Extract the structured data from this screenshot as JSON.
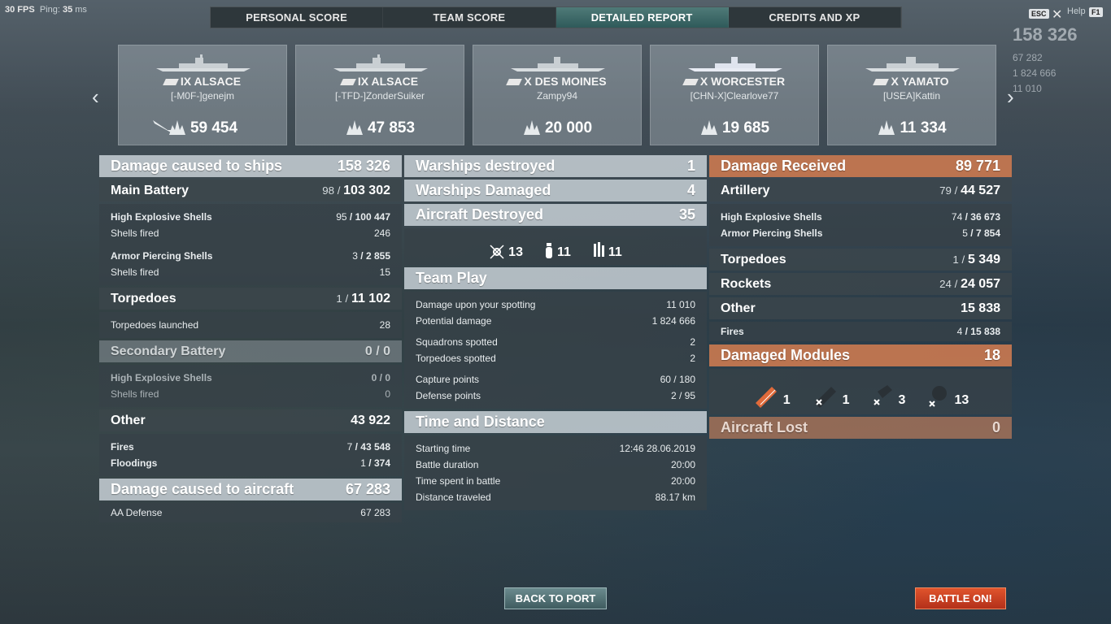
{
  "hud": {
    "fps_label": "30 FPS",
    "ping_label": "Ping:",
    "ping_value": "35",
    "ping_unit": "ms"
  },
  "tabs": [
    {
      "label": "PERSONAL SCORE"
    },
    {
      "label": "TEAM SCORE"
    },
    {
      "label": "DETAILED REPORT"
    },
    {
      "label": "CREDITS AND XP"
    }
  ],
  "window": {
    "esc": "ESC",
    "help": "Help",
    "f1": "F1"
  },
  "cards": [
    {
      "ship": "IX ALSACE",
      "player": "[-M0F-]genejm",
      "damage": "59 454"
    },
    {
      "ship": "IX ALSACE",
      "player": "[-TFD-]ZonderSuiker",
      "damage": "47 853"
    },
    {
      "ship": "X DES MOINES",
      "player": "Zampy94",
      "damage": "20 000"
    },
    {
      "ship": "X WORCESTER",
      "player": "[CHN-X]Clearlove77",
      "damage": "19 685"
    },
    {
      "ship": "X YAMATO",
      "player": "[USEA]Kattin",
      "damage": "11 334"
    }
  ],
  "left": {
    "damage_ships": {
      "label": "Damage caused to ships",
      "value": "158 326"
    },
    "main_battery": {
      "label": "Main Battery",
      "hits": "98",
      "total": "103 302"
    },
    "he": {
      "label": "High Explosive Shells",
      "hits": "95",
      "total": "100 447",
      "fired_label": "Shells fired",
      "fired": "246"
    },
    "ap": {
      "label": "Armor Piercing Shells",
      "hits": "3",
      "total": "2 855",
      "fired_label": "Shells fired",
      "fired": "15"
    },
    "torpedoes": {
      "label": "Torpedoes",
      "hits": "1",
      "total": "11 102",
      "launched_label": "Torpedoes launched",
      "launched": "28"
    },
    "secondary": {
      "label": "Secondary Battery",
      "hits": "0",
      "total": "0"
    },
    "sec_he": {
      "label": "High Explosive Shells",
      "hits": "0",
      "total": "0",
      "fired_label": "Shells fired",
      "fired": "0"
    },
    "other": {
      "label": "Other",
      "value": "43 922"
    },
    "fires": {
      "label": "Fires",
      "hits": "7",
      "total": "43 548"
    },
    "floodings": {
      "label": "Floodings",
      "hits": "1",
      "total": "374"
    },
    "damage_aircraft": {
      "label": "Damage caused to aircraft",
      "value": "67 283"
    },
    "aa": {
      "label": "AA Defense",
      "value": "67 283"
    }
  },
  "middle": {
    "warships_destroyed": {
      "label": "Warships destroyed",
      "value": "1"
    },
    "warships_damaged": {
      "label": "Warships Damaged",
      "value": "4"
    },
    "aircraft_destroyed": {
      "label": "Aircraft Destroyed",
      "value": "35"
    },
    "aircraft_icons": [
      {
        "icon": "fighter-shot-icon",
        "value": "13"
      },
      {
        "icon": "bomb-icon",
        "value": "11"
      },
      {
        "icon": "torpedo-bomber-icon",
        "value": "11"
      }
    ],
    "team_play": {
      "label": "Team Play"
    },
    "spotting_damage": {
      "label": "Damage upon your spotting",
      "value": "11 010"
    },
    "potential": {
      "label": "Potential damage",
      "value": "1 824 666"
    },
    "squadrons": {
      "label": "Squadrons spotted",
      "value": "2"
    },
    "torps_spotted": {
      "label": "Torpedoes spotted",
      "value": "2"
    },
    "capture": {
      "label": "Capture points",
      "value": "60 / 180"
    },
    "defense": {
      "label": "Defense points",
      "value": "2 / 95"
    },
    "time": {
      "label": "Time and Distance"
    },
    "start": {
      "label": "Starting time",
      "value": "12:46  28.06.2019"
    },
    "duration": {
      "label": "Battle duration",
      "value": "20:00"
    },
    "spent": {
      "label": "Time spent in battle",
      "value": "20:00"
    },
    "distance": {
      "label": "Distance traveled",
      "value": "88.17 km"
    }
  },
  "right": {
    "received": {
      "label": "Damage Received",
      "value": "89 771"
    },
    "artillery": {
      "label": "Artillery",
      "hits": "79",
      "total": "44 527"
    },
    "he": {
      "label": "High Explosive Shells",
      "hits": "74",
      "total": "36 673"
    },
    "ap": {
      "label": "Armor Piercing Shells",
      "hits": "5",
      "total": "7 854"
    },
    "torpedoes": {
      "label": "Torpedoes",
      "hits": "1",
      "total": "5 349"
    },
    "rockets": {
      "label": "Rockets",
      "hits": "24",
      "total": "24 057"
    },
    "other": {
      "label": "Other",
      "value": "15 838"
    },
    "fires": {
      "label": "Fires",
      "hits": "4",
      "total": "15 838"
    },
    "modules": {
      "label": "Damaged Modules",
      "value": "18"
    },
    "module_icons": [
      {
        "icon": "guns-damaged-icon",
        "value": "1"
      },
      {
        "icon": "guns-destroyed-icon",
        "value": "1"
      },
      {
        "icon": "torpedo-tube-destroyed-icon",
        "value": "3"
      },
      {
        "icon": "aa-mount-destroyed-icon",
        "value": "13"
      }
    ],
    "aircraft_lost": {
      "label": "Aircraft Lost",
      "value": "0"
    }
  },
  "bottom": {
    "back": "BACK TO PORT",
    "battle": "BATTLE ON!"
  },
  "topright": {
    "score": "158 326",
    "a": "67 282",
    "b": "1 824 666",
    "c": "11 010"
  },
  "colors": {
    "accent": "#2f5a5a",
    "received": "#c8784f",
    "battle": "#c8401f"
  }
}
